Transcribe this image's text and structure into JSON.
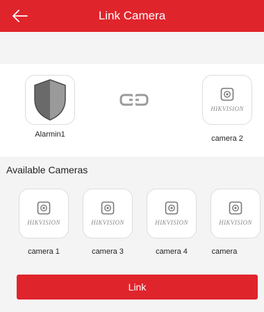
{
  "header": {
    "title": "Link Camera",
    "back_icon": "arrow-left-icon"
  },
  "link": {
    "source": {
      "label": "Alarmin1",
      "icon": "shield-icon"
    },
    "link_icon": "chain-link-icon",
    "target": {
      "label": "camera 2",
      "brand": "HIKVISION",
      "icon": "camera-icon"
    }
  },
  "available": {
    "title": "Available Cameras",
    "cameras": [
      {
        "label": "camera 1",
        "brand": "HIKVISION"
      },
      {
        "label": "camera 3",
        "brand": "HIKVISION"
      },
      {
        "label": "camera 4",
        "brand": "HIKVISION"
      },
      {
        "label": "camera",
        "brand": "HIKVISION"
      }
    ]
  },
  "actions": {
    "link_label": "Link"
  },
  "colors": {
    "accent": "#e0242c",
    "background": "#f4f4f4"
  }
}
